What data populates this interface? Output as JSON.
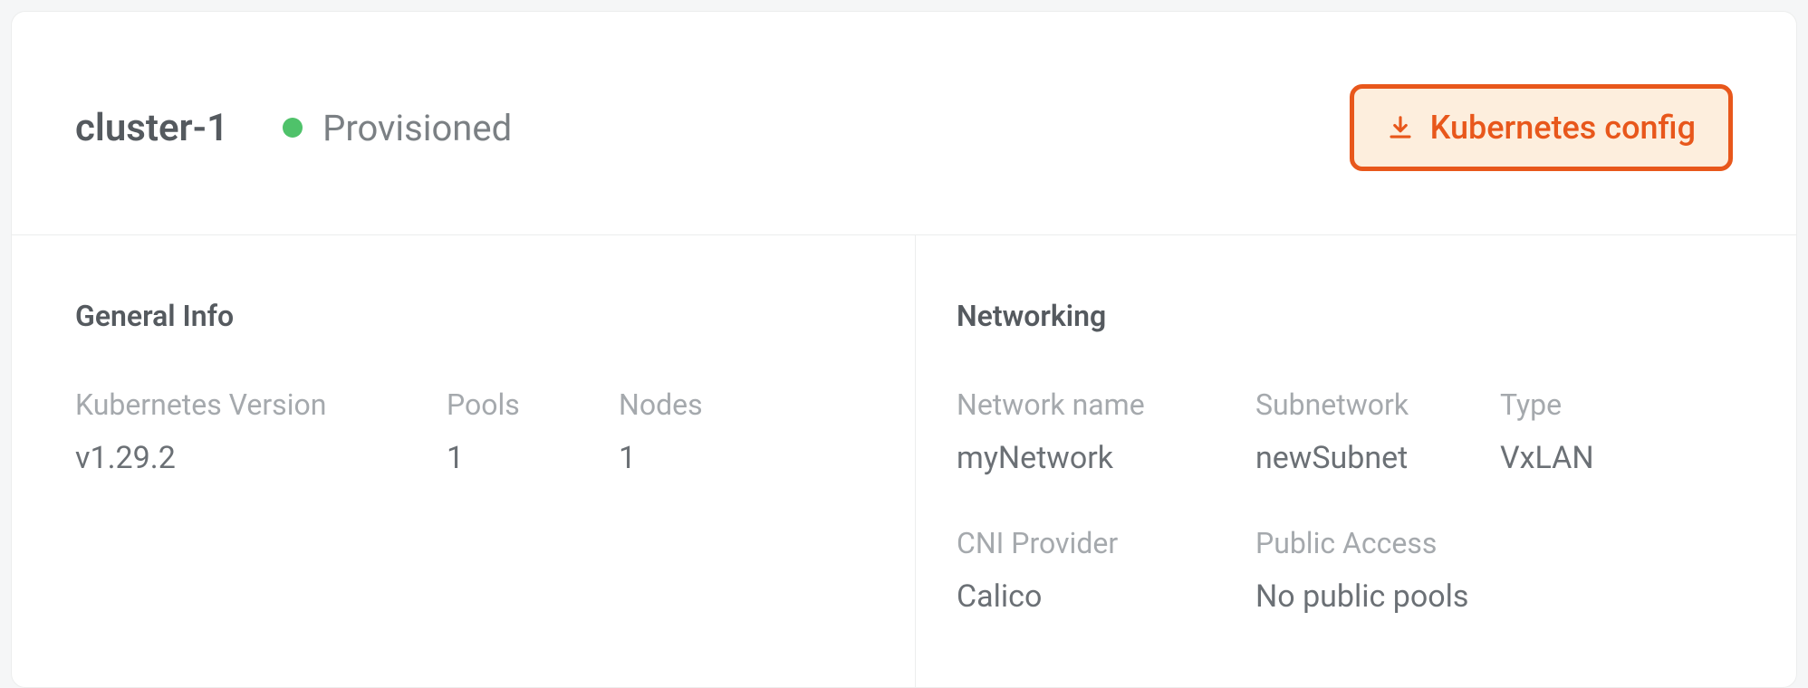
{
  "header": {
    "cluster_name": "cluster-1",
    "status": "Provisioned",
    "config_button_label": "Kubernetes config"
  },
  "general_info": {
    "title": "General Info",
    "kubernetes_version": {
      "label": "Kubernetes Version",
      "value": "v1.29.2"
    },
    "pools": {
      "label": "Pools",
      "value": "1"
    },
    "nodes": {
      "label": "Nodes",
      "value": "1"
    }
  },
  "networking": {
    "title": "Networking",
    "network_name": {
      "label": "Network name",
      "value": "myNetwork"
    },
    "subnetwork": {
      "label": "Subnetwork",
      "value": "newSubnet"
    },
    "type": {
      "label": "Type",
      "value": "VxLAN"
    },
    "cni_provider": {
      "label": "CNI Provider",
      "value": "Calico"
    },
    "public_access": {
      "label": "Public Access",
      "value": "No public pools"
    }
  }
}
